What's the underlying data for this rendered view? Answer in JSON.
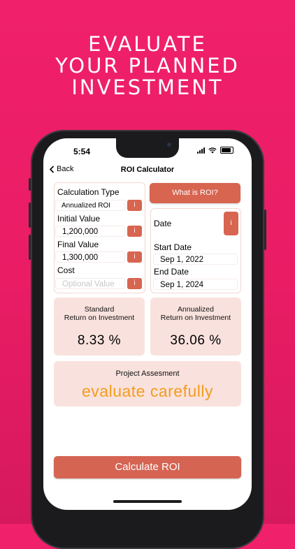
{
  "promo": {
    "line1": "EVALUATE",
    "line2": "YOUR PLANNED",
    "line3": "INVESTMENT"
  },
  "status": {
    "time": "5:54"
  },
  "nav": {
    "back_label": "Back",
    "title": "ROI Calculator"
  },
  "form": {
    "calc_type_label": "Calculation Type",
    "calc_type_value": "Annualized ROI",
    "initial_label": "Initial Value",
    "initial_value": "1,200,000",
    "final_label": "Final Value",
    "final_value": "1,300,000",
    "cost_label": "Cost",
    "cost_placeholder": "Optional Value",
    "info_glyph": "i"
  },
  "right": {
    "what_is_roi": "What is ROI?",
    "date_label": "Date",
    "start_label": "Start Date",
    "start_value": "Sep 1, 2022",
    "end_label": "End Date",
    "end_value": "Sep 1, 2024"
  },
  "results": {
    "standard_line1": "Standard",
    "standard_line2": "Return on Investment",
    "standard_value": "8.33 %",
    "annual_line1": "Annualized",
    "annual_line2": "Return on Investment",
    "annual_value": "36.06 %"
  },
  "assessment": {
    "title": "Project Assesment",
    "value": "evaluate carefully",
    "value_color": "#f39c1e"
  },
  "calculate_label": "Calculate ROI",
  "colors": {
    "accent": "#d76550",
    "panel_bg": "#f9e2dd",
    "background": "#ec1e66"
  },
  "icons": {
    "back": "chevron-left-icon",
    "wifi": "wifi-icon",
    "signal": "signal-icon",
    "battery": "battery-icon"
  }
}
